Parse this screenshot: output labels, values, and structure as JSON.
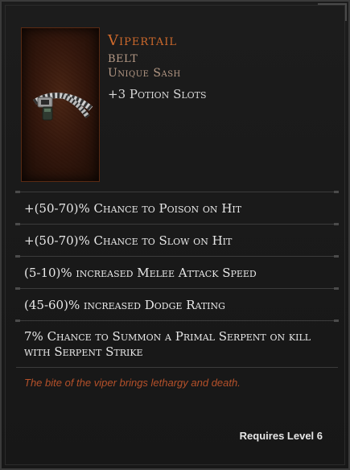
{
  "item": {
    "name": "Vipertail",
    "base_type": "BELT",
    "rarity": "Unique Sash",
    "implicit": "+3 Potion Slots",
    "icon": "belt-icon",
    "name_color": "#cf6a2c"
  },
  "affixes": [
    "+(50-70)% Chance to Poison on Hit",
    "+(50-70)% Chance to Slow on Hit",
    "(5-10)% increased Melee Attack Speed",
    "(45-60)% increased Dodge Rating",
    "7% Chance to Summon a Primal Serpent on kill with Serpent Strike"
  ],
  "flavor_text": "The bite of the viper brings lethargy and death.",
  "requirement": "Requires Level 6"
}
